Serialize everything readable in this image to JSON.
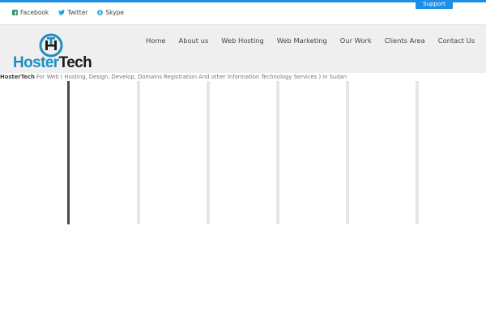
{
  "colors": {
    "accent": "#1f8fe5",
    "header_bg": "#efefef",
    "logo_blue": "#1f8fc3"
  },
  "topbar": {
    "social": [
      {
        "icon": "facebook-icon",
        "label": "Facebook",
        "color": "#2a9a6a"
      },
      {
        "icon": "twitter-icon",
        "label": "Twitter",
        "color": "#1fa0d8"
      },
      {
        "icon": "skype-icon",
        "label": "Skype",
        "color": "#1fa0d8"
      }
    ],
    "support_label": "Support"
  },
  "header": {
    "logo": {
      "part1": "Hoster",
      "part2": "Tech"
    },
    "nav": [
      "Home",
      "About us",
      "Web Hosting",
      "Web Marketing",
      "Our Work",
      "Clients Area",
      "Contact Us"
    ]
  },
  "tagline": {
    "brand": "HosterTech",
    "text": " For Web ( Hosting, Design, Develop, Domains Registration And other Information Technology Services ) in Sudan"
  }
}
